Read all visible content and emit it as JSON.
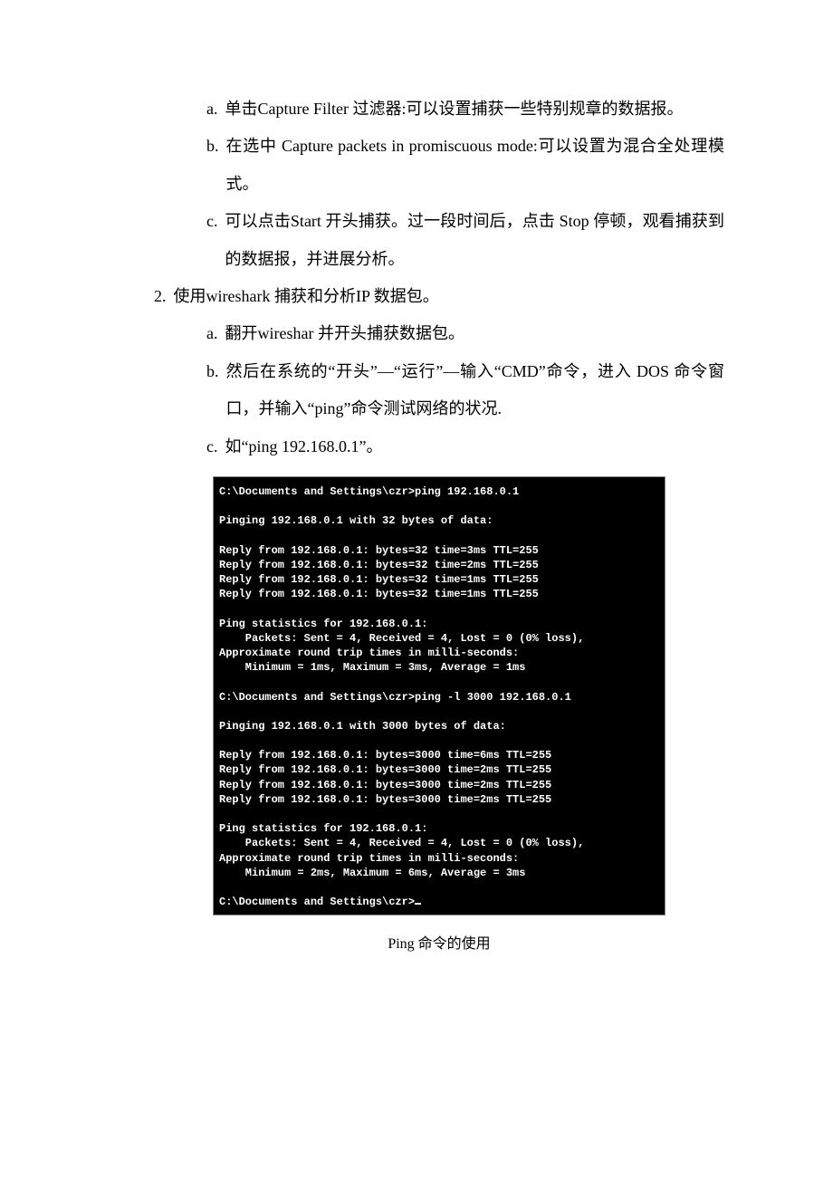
{
  "items": {
    "a1": {
      "marker": "a.",
      "text": "单击Capture Filter 过滤器:可以设置捕获一些特别规章的数据报。"
    },
    "b1": {
      "marker": "b.",
      "text": "在选中 Capture packets in promiscuous mode:可以设置为混合全处理模式。"
    },
    "c1": {
      "marker": "c.",
      "text": "可以点击Start 开头捕获。过一段时间后，点击 Stop 停顿，观看捕获到的数据报，并进展分析。"
    },
    "n2": {
      "marker": "2.",
      "text": "使用wireshark 捕获和分析IP 数据包。"
    },
    "a2": {
      "marker": "a.",
      "text": "翻开wireshar 并开头捕获数据包。"
    },
    "b2": {
      "marker": "b.",
      "text": "然后在系统的“开头”—“运行”—输入“CMD”命令，进入 DOS 命令窗口，并输入“ping”命令测试网络的状况."
    },
    "c2": {
      "marker": "c.",
      "text": "如“ping 192.168.0.1”。"
    }
  },
  "terminal": {
    "lines": [
      "C:\\Documents and Settings\\czr>ping 192.168.0.1",
      "",
      "Pinging 192.168.0.1 with 32 bytes of data:",
      "",
      "Reply from 192.168.0.1: bytes=32 time=3ms TTL=255",
      "Reply from 192.168.0.1: bytes=32 time=2ms TTL=255",
      "Reply from 192.168.0.1: bytes=32 time=1ms TTL=255",
      "Reply from 192.168.0.1: bytes=32 time=1ms TTL=255",
      "",
      "Ping statistics for 192.168.0.1:",
      "    Packets: Sent = 4, Received = 4, Lost = 0 (0% loss),",
      "Approximate round trip times in milli-seconds:",
      "    Minimum = 1ms, Maximum = 3ms, Average = 1ms",
      "",
      "C:\\Documents and Settings\\czr>ping -l 3000 192.168.0.1",
      "",
      "Pinging 192.168.0.1 with 3000 bytes of data:",
      "",
      "Reply from 192.168.0.1: bytes=3000 time=6ms TTL=255",
      "Reply from 192.168.0.1: bytes=3000 time=2ms TTL=255",
      "Reply from 192.168.0.1: bytes=3000 time=2ms TTL=255",
      "Reply from 192.168.0.1: bytes=3000 time=2ms TTL=255",
      "",
      "Ping statistics for 192.168.0.1:",
      "    Packets: Sent = 4, Received = 4, Lost = 0 (0% loss),",
      "Approximate round trip times in milli-seconds:",
      "    Minimum = 2ms, Maximum = 6ms, Average = 3ms",
      "",
      "C:\\Documents and Settings\\czr>"
    ]
  },
  "caption": "Ping 命令的使用"
}
